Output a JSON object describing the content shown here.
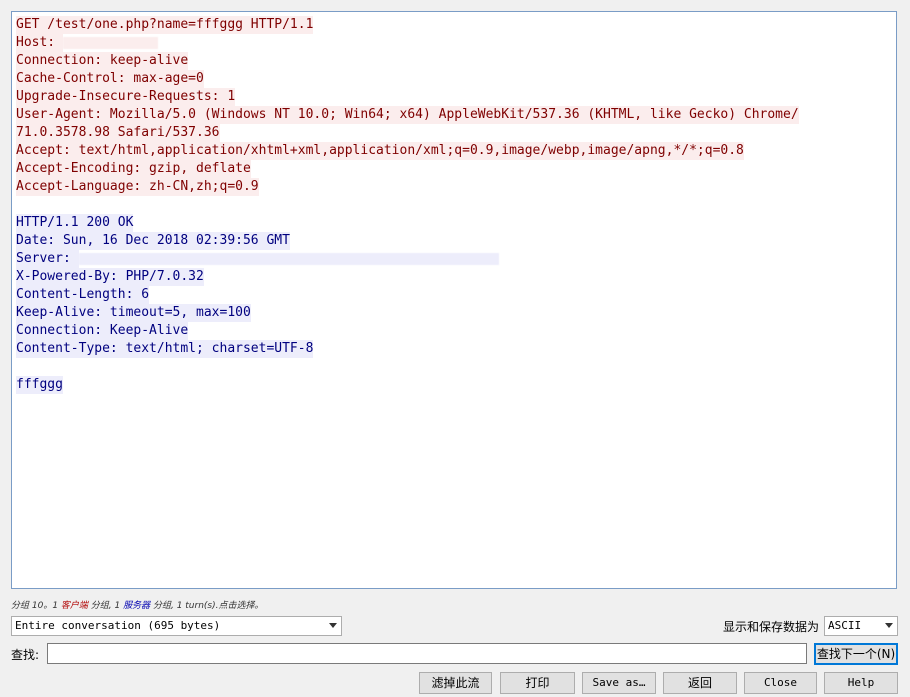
{
  "stream": {
    "request_lines": [
      "GET /test/one.php?name=fffggg HTTP/1.1",
      "Host: ",
      "Connection: keep-alive",
      "Cache-Control: max-age=0",
      "Upgrade-Insecure-Requests: 1",
      "User-Agent: Mozilla/5.0 (Windows NT 10.0; Win64; x64) AppleWebKit/537.36 (KHTML, like Gecko) Chrome/",
      "71.0.3578.98 Safari/537.36",
      "Accept: text/html,application/xhtml+xml,application/xml;q=0.9,image/webp,image/apng,*/*;q=0.8",
      "Accept-Encoding: gzip, deflate",
      "Accept-Language: zh-CN,zh;q=0.9"
    ],
    "response_lines": [
      "HTTP/1.1 200 OK",
      "Date: Sun, 16 Dec 2018 02:39:56 GMT",
      "Server: ",
      "X-Powered-By: PHP/7.0.32",
      "Content-Length: 6",
      "Keep-Alive: timeout=5, max=100",
      "Connection: Keep-Alive",
      "Content-Type: text/html; charset=UTF-8"
    ],
    "response_body": "fffggg"
  },
  "status": {
    "prefix": "分组 10。1 ",
    "client_word": "客户端",
    "middle": " 分组, 1 ",
    "server_word": "服务器",
    "suffix": " 分组, 1 turn(s).点击选择。"
  },
  "controls": {
    "conversation_select": "Entire conversation (695 bytes)",
    "encoding_label": "显示和保存数据为",
    "encoding_select": "ASCII",
    "find_label": "查找:",
    "find_value": "",
    "find_next_button": "查找下一个(N)"
  },
  "buttons": {
    "filter_out": "滤掉此流",
    "print": "打印",
    "save_as": "Save as…",
    "back": "返回",
    "close": "Close",
    "help": "Help"
  },
  "colors": {
    "client_text": "#7f0000",
    "client_bg": "#fbeded",
    "server_text": "#00007f",
    "server_bg": "#ededfb",
    "accent": "#0078d7"
  }
}
